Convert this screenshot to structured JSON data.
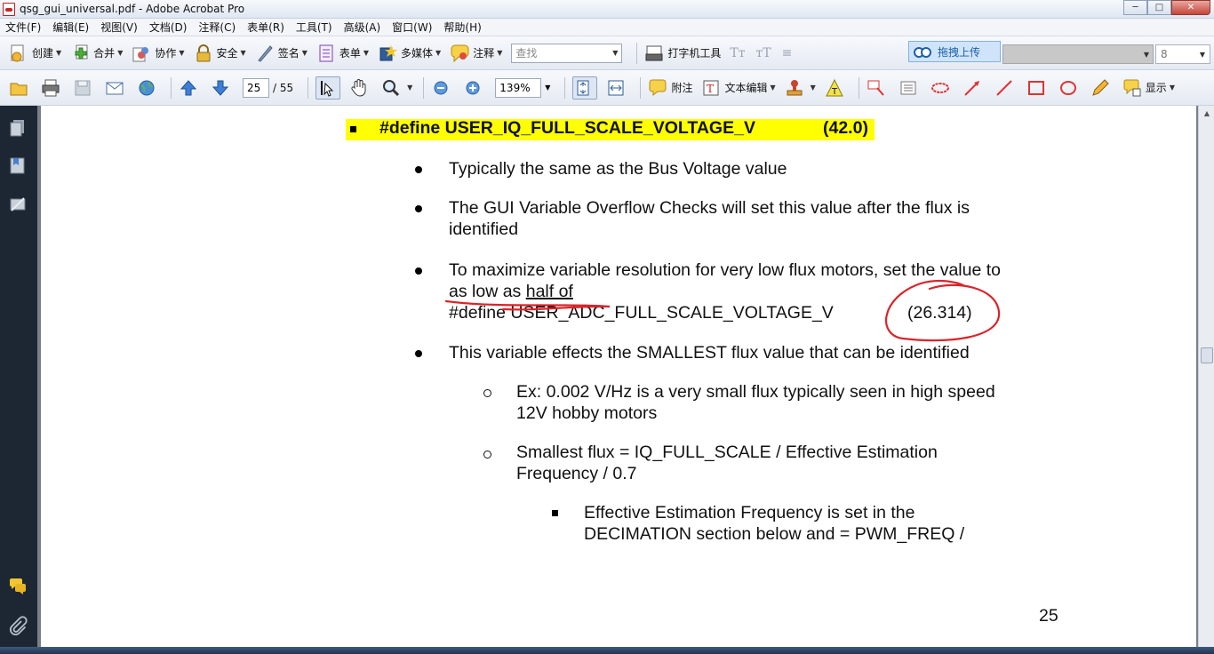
{
  "window": {
    "title": "qsg_gui_universal.pdf - Adobe Acrobat Pro"
  },
  "menu": [
    "文件(F)",
    "编辑(E)",
    "视图(V)",
    "文档(D)",
    "注释(C)",
    "表单(R)",
    "工具(T)",
    "高级(A)",
    "窗口(W)",
    "帮助(H)"
  ],
  "toolbar1": {
    "create": "创建",
    "combine": "合并",
    "collaborate": "协作",
    "secure": "安全",
    "sign": "签名",
    "forms": "表单",
    "multimedia": "多媒体",
    "comment": "注释",
    "search_placeholder": "查找",
    "typewriter": "打字机工具",
    "upload": "拖拽上传",
    "font_size": "8"
  },
  "toolbar2": {
    "current_page": "25",
    "total_pages": "/ 55",
    "zoom": "139%",
    "note": "附注",
    "text_edit": "文本编辑",
    "show": "显示"
  },
  "document": {
    "heading_define": "#define USER_IQ_FULL_SCALE_VOLTAGE_V",
    "heading_value": "(42.0)",
    "bullet1": "Typically the same as the Bus Voltage value",
    "bullet2_line1": "The GUI Variable Overflow Checks will set this value after the flux is",
    "bullet2_line2": "identified",
    "bullet3_line1": "To maximize variable resolution for very low flux motors, set the value to",
    "bullet3_line2_a": "as low as",
    "bullet3_line2_b": "half of",
    "bullet3_line3_define": "#define USER_ADC_FULL_SCALE_VOLTAGE_V",
    "bullet3_line3_value": "(26.314)",
    "bullet4": "This variable effects the SMALLEST flux value that can be identified",
    "sub1_line1": "Ex: 0.002 V/Hz is a very small flux typically seen in high speed",
    "sub1_line2": "12V hobby motors",
    "sub2_line1": "Smallest flux = IQ_FULL_SCALE / Effective Estimation",
    "sub2_line2": "Frequency / 0.7",
    "sub3_line1": "Effective Estimation Frequency is set in the",
    "sub3_line2": "DECIMATION section below and = PWM_FREQ /",
    "page_number": "25"
  },
  "colors": {
    "highlight": "#ffff00",
    "annotation_red": "#d9242a",
    "nav_pane": "#1d2733"
  }
}
